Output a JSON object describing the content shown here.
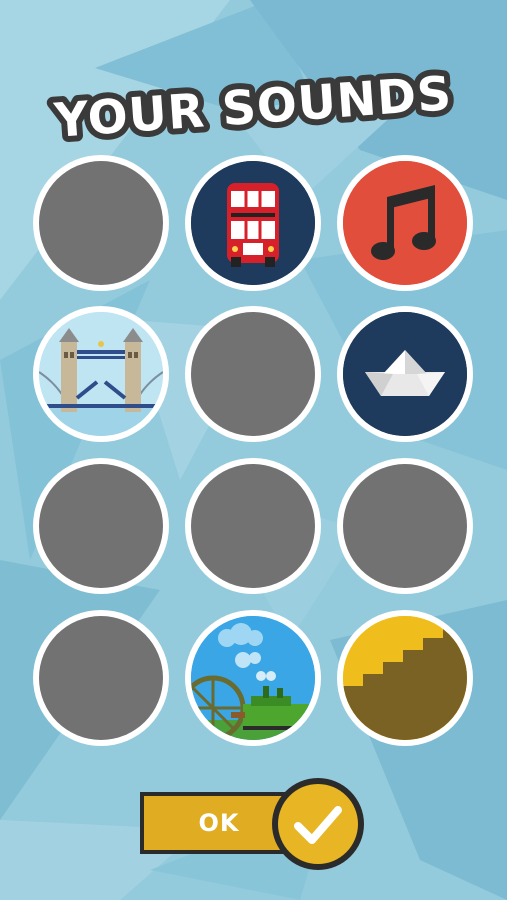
{
  "screen": {
    "title": "YOUR SOUNDS",
    "background_color": "#8fc9dc",
    "accent_color": "#e0ac22"
  },
  "sounds": [
    {
      "name": "locked-slot-1",
      "state": "locked",
      "icon": "empty-circle"
    },
    {
      "name": "bus-sound",
      "state": "unlocked",
      "icon": "double-decker-bus-icon"
    },
    {
      "name": "music-sound",
      "state": "unlocked",
      "icon": "music-note-icon"
    },
    {
      "name": "bridge-sound",
      "state": "unlocked",
      "icon": "tower-bridge-icon"
    },
    {
      "name": "locked-slot-5",
      "state": "locked",
      "icon": "empty-circle"
    },
    {
      "name": "boat-sound",
      "state": "unlocked",
      "icon": "paper-boat-icon"
    },
    {
      "name": "locked-slot-7",
      "state": "locked",
      "icon": "empty-circle"
    },
    {
      "name": "locked-slot-8",
      "state": "locked",
      "icon": "empty-circle"
    },
    {
      "name": "locked-slot-9",
      "state": "locked",
      "icon": "empty-circle"
    },
    {
      "name": "locked-slot-10",
      "state": "locked",
      "icon": "empty-circle"
    },
    {
      "name": "steam-engine-sound",
      "state": "unlocked",
      "icon": "steam-engine-icon"
    },
    {
      "name": "stairs-sound",
      "state": "unlocked",
      "icon": "stairs-icon"
    }
  ],
  "ok_button": {
    "label": "OK",
    "icon": "checkmark-icon"
  }
}
